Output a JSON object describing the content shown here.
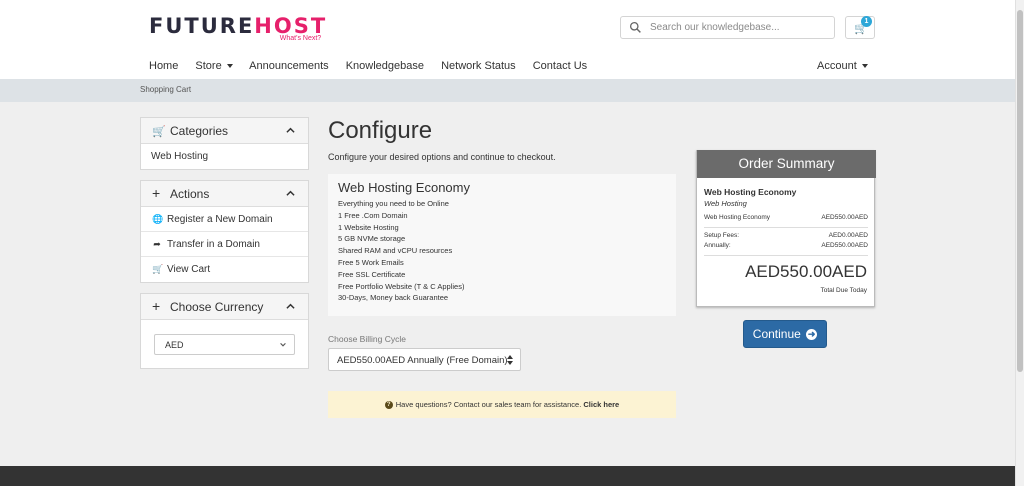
{
  "header": {
    "logo": {
      "part1": "FUTURE",
      "part2": "HOST",
      "tagline": "What's Next?"
    },
    "search": {
      "placeholder": "Search our knowledgebase..."
    },
    "cart_count": "1"
  },
  "nav": {
    "items": [
      "Home",
      "Store",
      "Announcements",
      "Knowledgebase",
      "Network Status",
      "Contact Us"
    ],
    "account": "Account"
  },
  "breadcrumb": "Shopping Cart",
  "sidebar": {
    "categories": {
      "title": "Categories",
      "items": [
        "Web Hosting"
      ]
    },
    "actions": {
      "title": "Actions",
      "items": [
        "Register a New Domain",
        "Transfer in a Domain",
        "View Cart"
      ]
    },
    "currency": {
      "title": "Choose Currency",
      "selected": "AED"
    }
  },
  "main": {
    "title": "Configure",
    "subtitle": "Configure your desired options and continue to checkout.",
    "product": {
      "name": "Web Hosting Economy",
      "features": [
        "Everything you need to be Online",
        "1 Free .Com Domain",
        "1 Website Hosting",
        "5 GB NVMe storage",
        "Shared RAM and vCPU resources",
        "Free 5 Work Emails",
        "Free SSL Certificate",
        "Free Portfolio Website (T & C Applies)",
        "30-Days, Money back Guarantee"
      ]
    },
    "billing": {
      "label": "Choose Billing Cycle",
      "selected": "AED550.00AED Annually (Free Domain)"
    },
    "help": {
      "text": "Have questions? Contact our sales team for assistance.",
      "link": "Click here"
    }
  },
  "summary": {
    "title": "Order Summary",
    "product": "Web Hosting Economy",
    "group": "Web Hosting",
    "line_label": "Web Hosting Economy",
    "line_value": "AED550.00AED",
    "setup_label": "Setup Fees:",
    "setup_value": "AED0.00AED",
    "annual_label": "Annually:",
    "annual_value": "AED550.00AED",
    "total": "AED550.00AED",
    "total_label": "Total Due Today"
  },
  "continue_label": "Continue",
  "colors": {
    "brand_pink": "#e6206b",
    "primary_blue": "#2c6aa5",
    "summary_header": "#6b6b6b",
    "help_bg": "#fcf3d3",
    "badge": "#2da7d8"
  }
}
